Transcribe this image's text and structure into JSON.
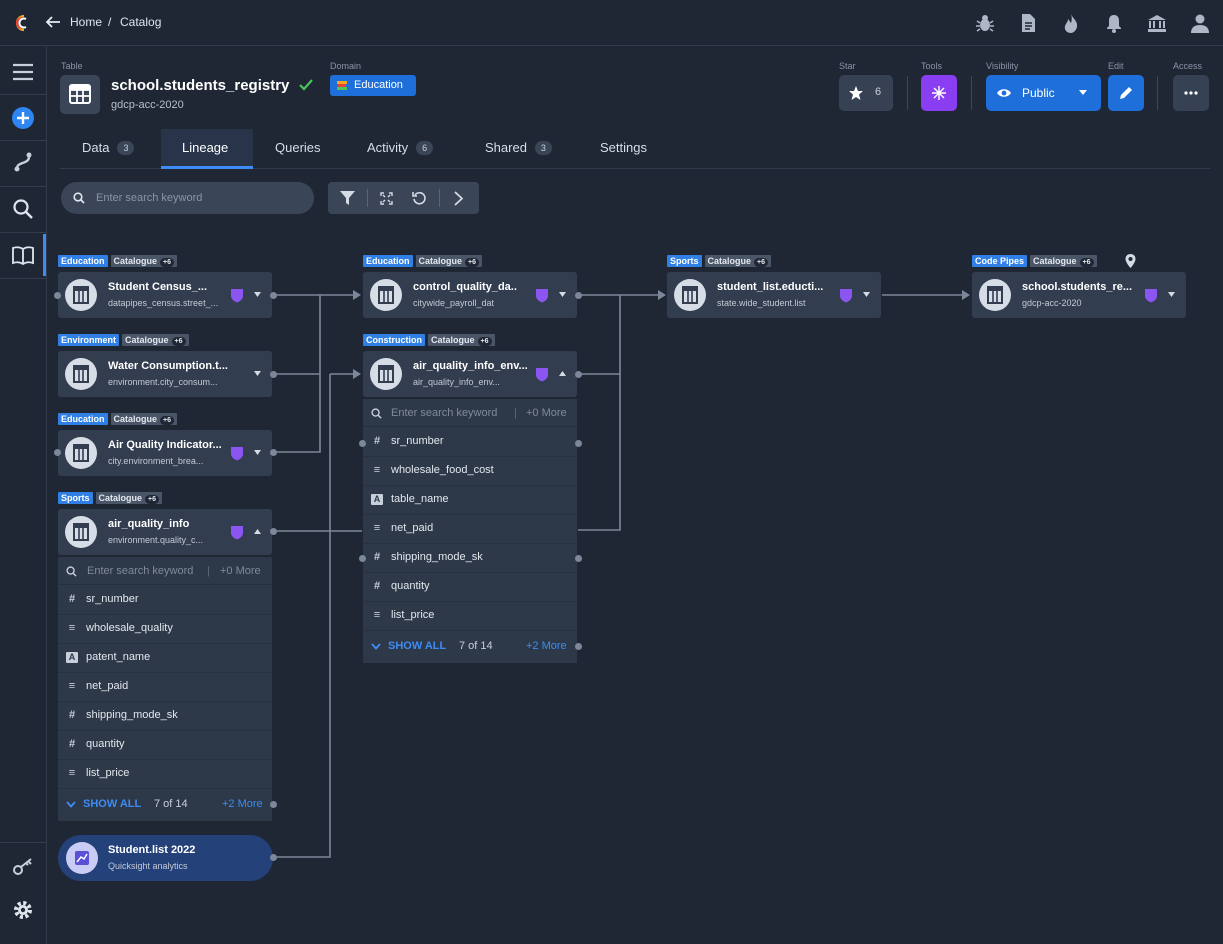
{
  "breadcrumb": {
    "home": "Home",
    "sep": "/",
    "catalog": "Catalog"
  },
  "header": {
    "table_label": "Table",
    "title": "school.students_registry",
    "subtitle": "gdcp-acc-2020",
    "domain_label": "Domain",
    "domain_value": "Education",
    "star_label": "Star",
    "star_count": "6",
    "tools_label": "Tools",
    "visibility_label": "Visibility",
    "visibility_value": "Public",
    "edit_label": "Edit",
    "access_label": "Access"
  },
  "tabs": [
    {
      "label": "Data",
      "count": "3"
    },
    {
      "label": "Lineage",
      "count": ""
    },
    {
      "label": "Queries",
      "count": ""
    },
    {
      "label": "Activity",
      "count": "6"
    },
    {
      "label": "Shared",
      "count": "3"
    },
    {
      "label": "Settings",
      "count": ""
    }
  ],
  "toolbar": {
    "search_placeholder": "Enter search keyword"
  },
  "nodes": {
    "n1": {
      "domain": "Education",
      "catalog": "Catalogue",
      "plus": "+6",
      "name": "Student Census_...",
      "sub": "datapipes_census.street_..."
    },
    "n2": {
      "domain": "Environment",
      "catalog": "Catalogue",
      "plus": "+6",
      "name": "Water Consumption.t...",
      "sub": "environment.city_consum..."
    },
    "n3": {
      "domain": "Education",
      "catalog": "Catalogue",
      "plus": "+6",
      "name": "Air Quality Indicator...",
      "sub": "city.environment_brea..."
    },
    "n4": {
      "domain": "Sports",
      "catalog": "Catalogue",
      "plus": "+6",
      "name": "air_quality_info",
      "sub": "environment.quality_c..."
    },
    "n5": {
      "domain": "Education",
      "catalog": "Catalogue",
      "plus": "+6",
      "name": "control_quality_da..",
      "sub": "citywide_payroll_dat"
    },
    "n6": {
      "domain": "Construction",
      "catalog": "Catalogue",
      "plus": "+6",
      "name": "air_quality_info_env...",
      "sub": "air_quality_info_env..."
    },
    "n7": {
      "domain": "Sports",
      "catalog": "Catalogue",
      "plus": "+6",
      "name": "student_list.educti...",
      "sub": "state.wide_student.list"
    },
    "n8": {
      "domain": "Code Pipes",
      "catalog": "Catalogue",
      "plus": "+6",
      "name": "school.students_re...",
      "sub": "gdcp-acc-2020"
    }
  },
  "columns_a": {
    "search_placeholder": "Enter search keyword",
    "more": "+0 More",
    "rows": [
      {
        "type": "#",
        "name": "sr_number"
      },
      {
        "type": "≡",
        "name": "wholesale_quality"
      },
      {
        "type": "A",
        "name": "patent_name"
      },
      {
        "type": "≡",
        "name": "net_paid"
      },
      {
        "type": "#",
        "name": "shipping_mode_sk"
      },
      {
        "type": "#",
        "name": "quantity"
      },
      {
        "type": "≡",
        "name": "list_price"
      }
    ],
    "show_all": "SHOW ALL",
    "count": "7 of 14",
    "more_bottom": "+2 More"
  },
  "columns_b": {
    "search_placeholder": "Enter search keyword",
    "more": "+0 More",
    "rows": [
      {
        "type": "#",
        "name": "sr_number"
      },
      {
        "type": "≡",
        "name": "wholesale_food_cost"
      },
      {
        "type": "A",
        "name": "table_name"
      },
      {
        "type": "≡",
        "name": "net_paid"
      },
      {
        "type": "#",
        "name": "shipping_mode_sk"
      },
      {
        "type": "#",
        "name": "quantity"
      },
      {
        "type": "≡",
        "name": "list_price"
      }
    ],
    "show_all": "SHOW ALL",
    "count": "7 of 14",
    "more_bottom": "+2 More"
  },
  "report": {
    "name": "Student.list 2022",
    "sub": "Quicksight analytics"
  },
  "colors": {
    "bg": "#1f2735",
    "accent": "#1e6fd9",
    "tools": "#8a3ef2",
    "domain_tag": "#2f7fe4",
    "shield": "#8a55f0",
    "check": "#4cc35a"
  }
}
